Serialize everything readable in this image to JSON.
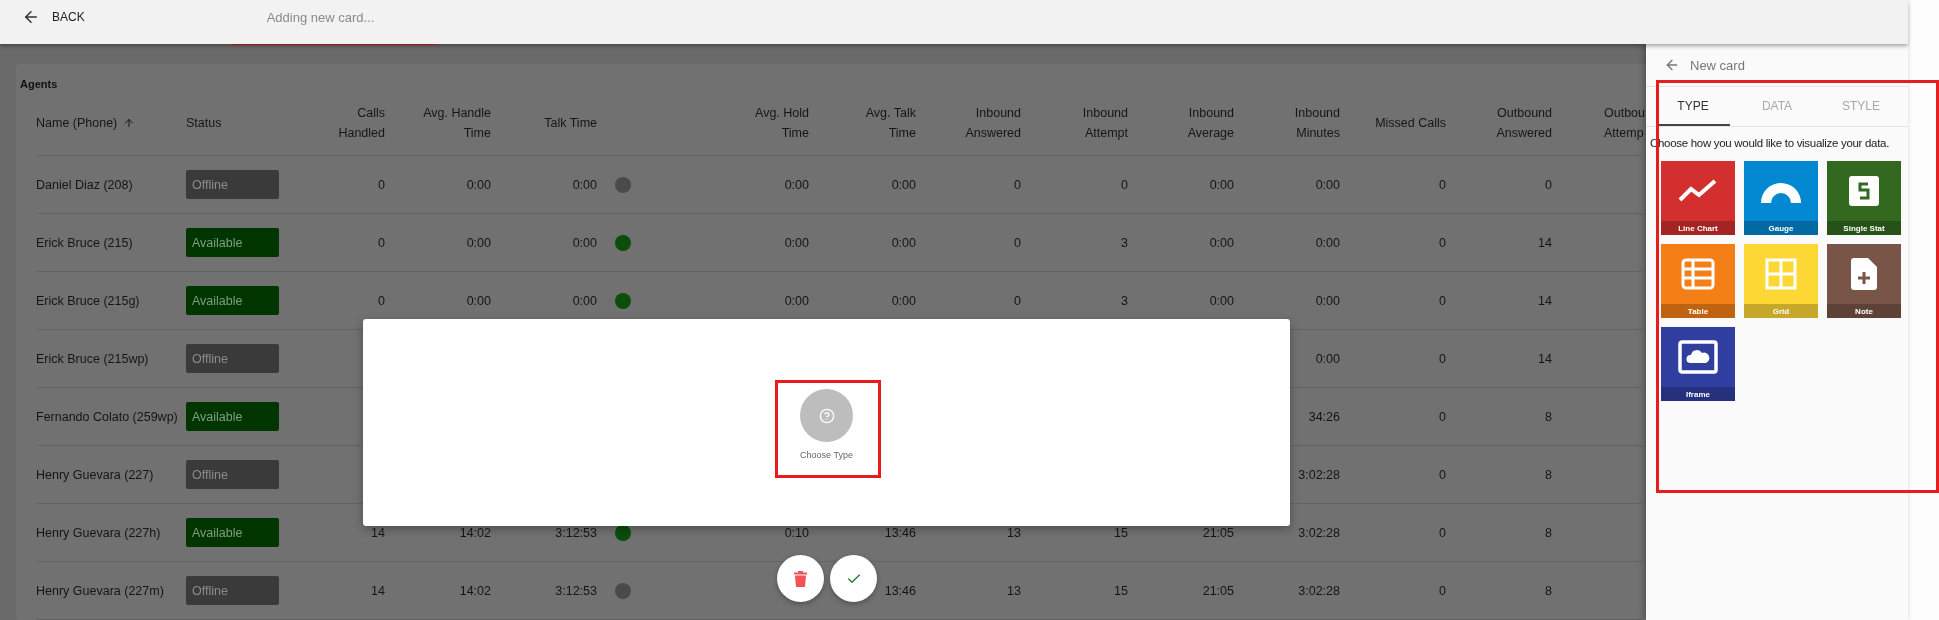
{
  "top_bar": {
    "back": "BACK",
    "title_field": {
      "placeholder": "Adding new card..."
    }
  },
  "table": {
    "title": "Agents",
    "columns": [
      {
        "kind": "name",
        "lines": [
          "Name (Phone)"
        ],
        "sorted": true
      },
      {
        "kind": "status",
        "lines": [
          "Status"
        ]
      },
      {
        "kind": "number",
        "lines": [
          "Calls",
          "Handled"
        ]
      },
      {
        "kind": "number",
        "lines": [
          "Avg. Handle",
          "Time"
        ]
      },
      {
        "kind": "number",
        "lines": [
          "Talk Time"
        ]
      },
      {
        "kind": "indicator"
      },
      {
        "kind": "number",
        "lines": [
          "Avg. Hold",
          "Time"
        ]
      },
      {
        "kind": "number",
        "lines": [
          "Avg. Talk",
          "Time"
        ]
      },
      {
        "kind": "number",
        "lines": [
          "Inbound",
          "Answered"
        ]
      },
      {
        "kind": "number",
        "lines": [
          "Inbound",
          "Attempt"
        ]
      },
      {
        "kind": "number",
        "lines": [
          "Inbound",
          "Average"
        ]
      },
      {
        "kind": "number",
        "lines": [
          "Inbound",
          "Minutes"
        ]
      },
      {
        "kind": "number",
        "lines": [
          "Missed Calls"
        ]
      },
      {
        "kind": "number",
        "lines": [
          "Outbound",
          "Answered"
        ]
      },
      {
        "kind": "cut",
        "lines": [
          "Outbou",
          "Attemp"
        ]
      }
    ],
    "rows": [
      {
        "cells": [
          "Daniel Diaz (208)",
          {
            "kind": "offline",
            "label": "Offline"
          },
          "0",
          "0:00",
          "0:00",
          {
            "color": "#4a4a4a"
          },
          "0:00",
          "0:00",
          "0",
          "0",
          "0:00",
          "0:00",
          "0",
          "0"
        ]
      },
      {
        "cells": [
          "Erick Bruce (215)",
          {
            "kind": "available",
            "label": "Available"
          },
          "0",
          "0:00",
          "0:00",
          {
            "color": "#0b4d0b"
          },
          "0:00",
          "0:00",
          "0",
          "3",
          "0:00",
          "0:00",
          "0",
          "14"
        ]
      },
      {
        "cells": [
          "Erick Bruce (215g)",
          {
            "kind": "available",
            "label": "Available"
          },
          "0",
          "0:00",
          "0:00",
          {
            "color": "#0b4d0b"
          },
          "0:00",
          "0:00",
          "0",
          "3",
          "0:00",
          "0:00",
          "0",
          "14"
        ]
      },
      {
        "cells": [
          "Erick Bruce (215wp)",
          {
            "kind": "offline",
            "label": "Offline"
          },
          "",
          "",
          "",
          "",
          "",
          "",
          "",
          "",
          "",
          "0:00",
          "0",
          "14"
        ]
      },
      {
        "cells": [
          "Fernando Colato (259wp)",
          {
            "kind": "available",
            "label": "Available"
          },
          "",
          "",
          "",
          "",
          "",
          "",
          "",
          "",
          "",
          "34:26",
          "0",
          "8"
        ]
      },
      {
        "cells": [
          "Henry Guevara (227)",
          {
            "kind": "offline",
            "label": "Offline"
          },
          "",
          "",
          "",
          "",
          "",
          "",
          "",
          "",
          "",
          "3:02:28",
          "0",
          "8"
        ]
      },
      {
        "cells": [
          "Henry Guevara (227h)",
          {
            "kind": "available",
            "label": "Available"
          },
          "14",
          "14:02",
          "3:12:53",
          {
            "color": "#0b4d0b"
          },
          "0:10",
          "13:46",
          "13",
          "15",
          "21:05",
          "3:02:28",
          "0",
          "8"
        ]
      },
      {
        "cells": [
          "Henry Guevara (227m)",
          {
            "kind": "offline",
            "label": "Offline"
          },
          "14",
          "14:02",
          "3:12:53",
          {
            "color": "#4a4a4a"
          },
          "",
          "13:46",
          "13",
          "15",
          "21:05",
          "3:02:28",
          "0",
          "8"
        ]
      }
    ]
  },
  "dialog": {
    "choose_label": "Choose Type"
  },
  "panel": {
    "title": "New card",
    "tabs": [
      {
        "label": "TYPE",
        "selected": true
      },
      {
        "label": "DATA",
        "selected": false
      },
      {
        "label": "STYLE",
        "selected": false
      }
    ],
    "hint": "Choose how you would like to visualize your data.",
    "types": [
      {
        "kind": "line-chart",
        "label": "Line Chart",
        "color": "#d32f2f"
      },
      {
        "kind": "gauge",
        "label": "Gauge",
        "color": "#0288d1"
      },
      {
        "kind": "single-stat",
        "label": "Single Stat",
        "color": "#33691e"
      },
      {
        "kind": "table",
        "label": "Table",
        "color": "#f57f17"
      },
      {
        "kind": "grid",
        "label": "Grid",
        "color": "#fdd835"
      },
      {
        "kind": "note",
        "label": "Note",
        "color": "#795548"
      },
      {
        "kind": "iframe",
        "label": "Iframe",
        "color": "#303f9f"
      }
    ]
  }
}
